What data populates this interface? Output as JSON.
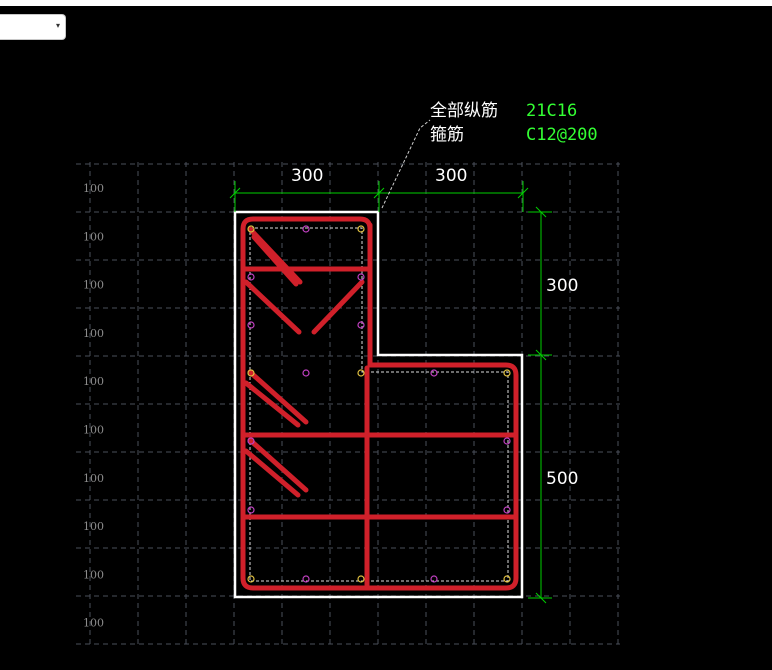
{
  "toolbar": {
    "dropdown_value": ""
  },
  "annotation": {
    "longitudinal_label": "全部纵筋",
    "longitudinal_value": "21C16",
    "stirrup_label": "箍筋",
    "stirrup_value": "C12@200"
  },
  "dimensions": {
    "top_left": "300",
    "top_right": "300",
    "right_upper": "300",
    "right_lower": "500"
  },
  "grid_row_labels": [
    "100",
    "100",
    "100",
    "100",
    "100",
    "100",
    "100",
    "100",
    "100",
    "100"
  ],
  "colors": {
    "background": "#000000",
    "outline": "#ffffff",
    "rebar": "#d0202a",
    "dimension": "#00d000",
    "annotation_value": "#33ff33",
    "grid": "#4a4f5a",
    "bar_marker": "#c040c0"
  },
  "icons": {
    "dropdown_arrow": "chevron-down-icon"
  }
}
